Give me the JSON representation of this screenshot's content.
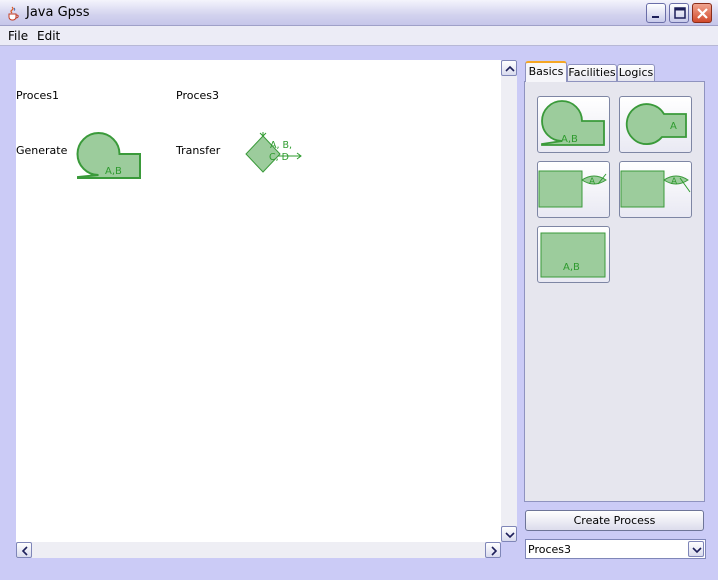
{
  "window": {
    "title": "Java Gpss",
    "app_icon": "java-cup-icon"
  },
  "menu": {
    "items": [
      "File",
      "Edit"
    ]
  },
  "canvas": {
    "processes": [
      {
        "name": "Proces1",
        "block": {
          "type": "Generate",
          "label": "A,B",
          "icon": "generate-block-icon"
        }
      },
      {
        "name": "Proces3",
        "block": {
          "type": "Transfer",
          "label_line1": "A, B,",
          "label_line2": "C, D",
          "icon": "transfer-block-icon"
        }
      }
    ]
  },
  "palette": {
    "tabs": [
      "Basics",
      "Facilities",
      "Logics"
    ],
    "active_tab": "Basics",
    "buttons": [
      {
        "icon": "generate-block-icon",
        "label": "A,B"
      },
      {
        "icon": "terminate-block-icon",
        "label": "A"
      },
      {
        "icon": "advance-block-icon",
        "label": "A"
      },
      {
        "icon": "split-block-icon",
        "label": "A"
      },
      {
        "icon": "assign-block-icon",
        "label": "A,B"
      }
    ]
  },
  "actions": {
    "create_process": "Create Process"
  },
  "process_select": {
    "value": "Proces3"
  },
  "colors": {
    "block_fill": "#9ccc9c",
    "block_stroke": "#3a9a3a",
    "block_text": "#2e9b2e",
    "window_bg": "#cbcbf6"
  }
}
